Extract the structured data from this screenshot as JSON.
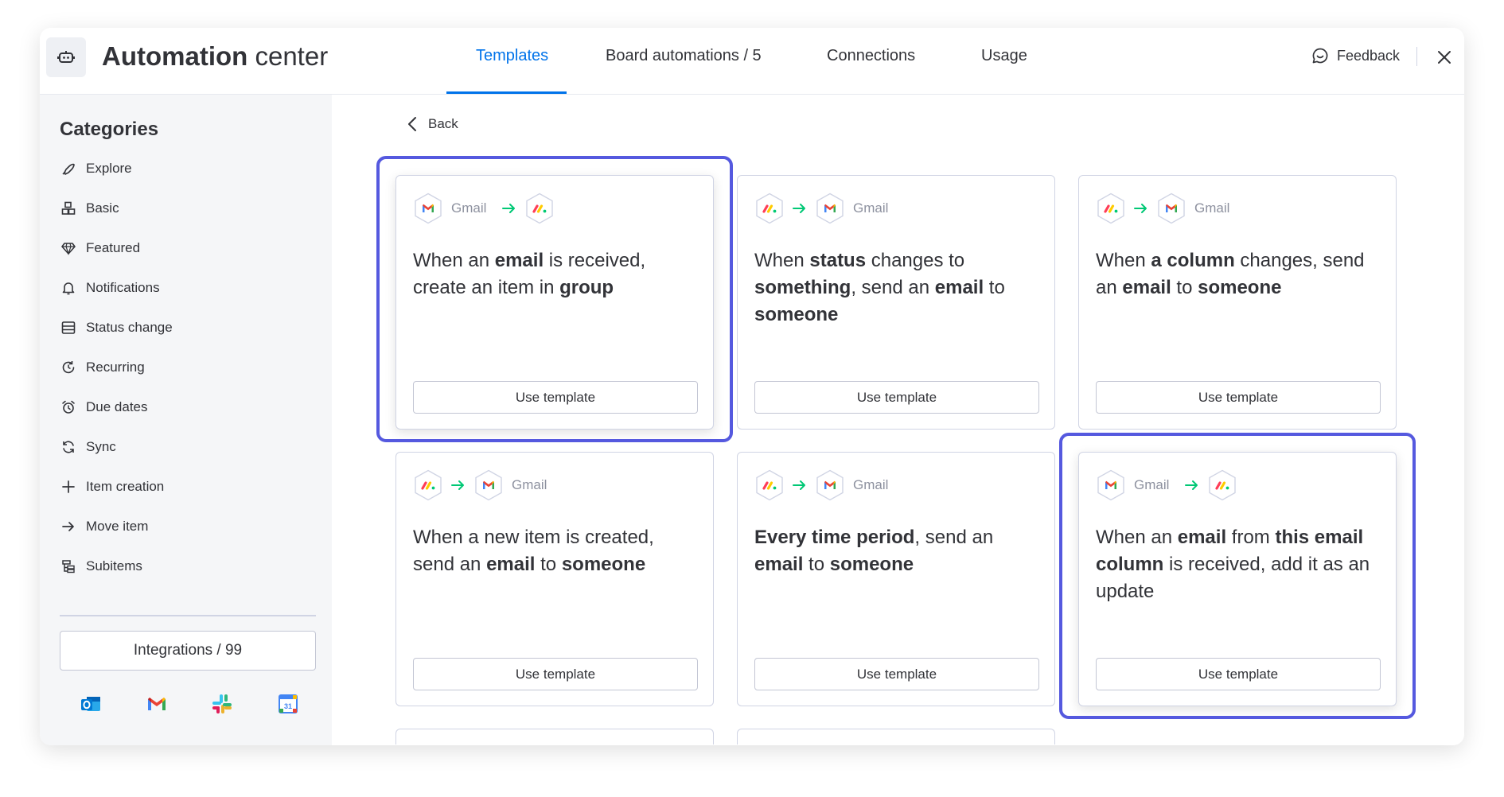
{
  "header": {
    "title_bold": "Automation",
    "title_rest": " center",
    "tabs": [
      {
        "label": "Templates",
        "active": true
      },
      {
        "label": "Board automations / 5",
        "active": false
      },
      {
        "label": "Connections",
        "active": false
      },
      {
        "label": "Usage",
        "active": false
      }
    ],
    "feedback_label": "Feedback"
  },
  "sidebar": {
    "title": "Categories",
    "items": [
      {
        "label": "Explore",
        "icon": "rocket-icon"
      },
      {
        "label": "Basic",
        "icon": "blocks-icon"
      },
      {
        "label": "Featured",
        "icon": "diamond-icon"
      },
      {
        "label": "Notifications",
        "icon": "bell-icon"
      },
      {
        "label": "Status change",
        "icon": "table-icon"
      },
      {
        "label": "Recurring",
        "icon": "recurring-icon"
      },
      {
        "label": "Due dates",
        "icon": "alarm-icon"
      },
      {
        "label": "Sync",
        "icon": "sync-icon"
      },
      {
        "label": "Item creation",
        "icon": "plus-icon"
      },
      {
        "label": "Move item",
        "icon": "arrow-right-icon"
      },
      {
        "label": "Subitems",
        "icon": "subitems-icon"
      }
    ],
    "integrations_label": "Integrations / 99",
    "integration_icons": [
      "outlook-icon",
      "gmail-icon",
      "slack-icon",
      "google-calendar-icon"
    ]
  },
  "main": {
    "back_label": "Back",
    "gmail_label": "Gmail",
    "use_template_label": "Use template",
    "cards": [
      {
        "flow": [
          "gmail",
          "monday"
        ],
        "desc_parts": [
          "When an ",
          "email",
          " is received, create an item in ",
          "group"
        ],
        "highlighted": true
      },
      {
        "flow": [
          "monday",
          "gmail"
        ],
        "desc_parts": [
          "When ",
          "status",
          " changes to ",
          "something",
          ", send an ",
          "email",
          " to ",
          "someone"
        ],
        "highlighted": false
      },
      {
        "flow": [
          "monday",
          "gmail"
        ],
        "desc_parts": [
          "When ",
          "a column",
          " changes, send an ",
          "email",
          " to ",
          "someone"
        ],
        "highlighted": false
      },
      {
        "flow": [
          "monday",
          "gmail"
        ],
        "desc_parts": [
          "When a new item is created, send an ",
          "email",
          " to ",
          "someone"
        ],
        "highlighted": false
      },
      {
        "flow": [
          "monday",
          "gmail"
        ],
        "desc_parts": [
          "",
          "Every time period",
          ", send an ",
          "email",
          " to ",
          "someone"
        ],
        "highlighted": false
      },
      {
        "flow": [
          "gmail",
          "monday"
        ],
        "desc_parts": [
          "When an ",
          "email",
          " from ",
          "this email column",
          " is received, add it as an update"
        ],
        "highlighted": true
      }
    ]
  },
  "colors": {
    "accent": "#0073ea",
    "focus_ring": "#5559df",
    "gmail_red": "#ea4335",
    "arrow_green": "#00c875",
    "sidebar_bg": "#f5f6f8"
  }
}
